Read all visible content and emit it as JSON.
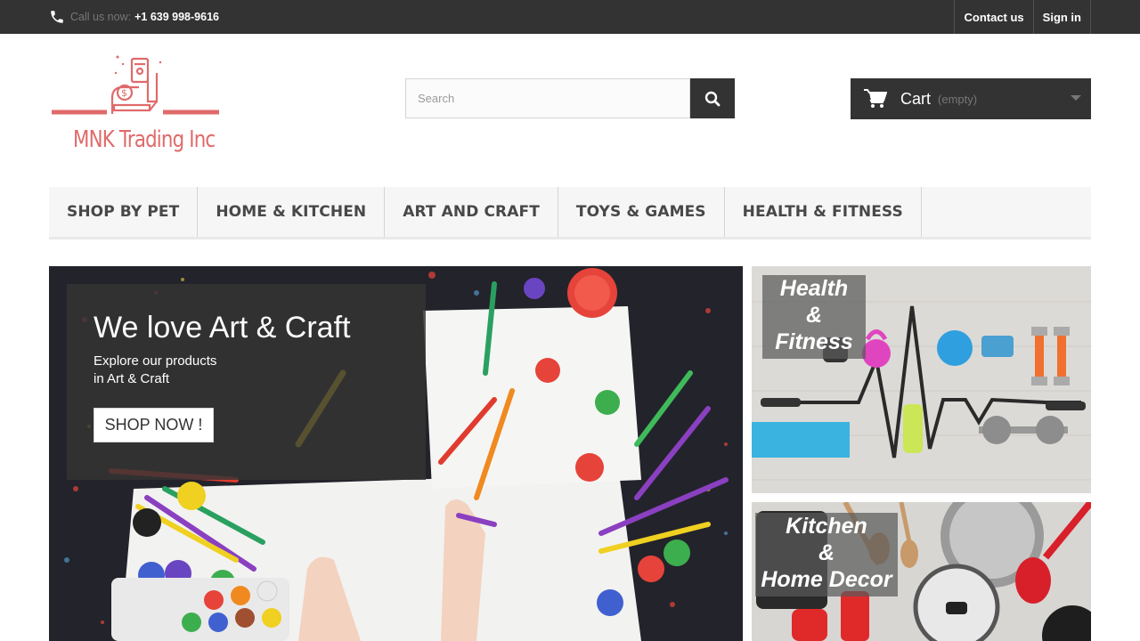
{
  "topbar": {
    "call_label": "Call us now:",
    "phone": "+1 639 998-9616",
    "contact": "Contact us",
    "signin": "Sign in"
  },
  "logo": {
    "text": "MNK Trading Inc"
  },
  "search": {
    "placeholder": "Search"
  },
  "cart": {
    "label": "Cart",
    "status": "(empty)"
  },
  "nav": {
    "items": [
      "SHOP BY PET",
      "HOME & KITCHEN",
      "ART AND CRAFT",
      "TOYS & GAMES",
      "HEALTH & FITNESS"
    ]
  },
  "hero": {
    "title": "We love Art & Craft",
    "subtitle_line1": "Explore our products",
    "subtitle_line2": "in Art & Craft",
    "button": "SHOP NOW !"
  },
  "banners": {
    "fitness": {
      "line1": "Health",
      "line2": "&",
      "line3": "Fitness"
    },
    "kitchen": {
      "line1": "Kitchen",
      "line2": "&",
      "line3": "Home Decor"
    }
  },
  "colors": {
    "topbar_bg": "#333333",
    "logo_accent": "#e06a6a",
    "nav_bg": "#f6f6f6"
  }
}
